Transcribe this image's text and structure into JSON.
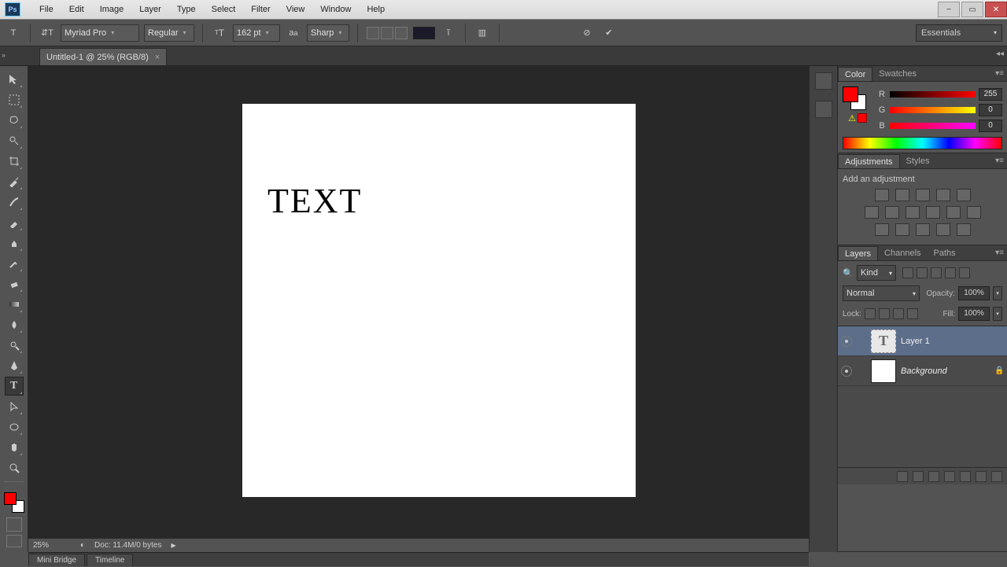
{
  "app": {
    "logo": "Ps"
  },
  "menu": [
    "File",
    "Edit",
    "Image",
    "Layer",
    "Type",
    "Select",
    "Filter",
    "View",
    "Window",
    "Help"
  ],
  "options": {
    "font_family": "Myriad Pro",
    "font_style": "Regular",
    "font_size": "162 pt",
    "antialias": "Sharp"
  },
  "workspace_selector": "Essentials",
  "document": {
    "tab_title": "Untitled-1 @ 25% (RGB/8)",
    "canvas_text": "TEXT"
  },
  "status": {
    "zoom": "25%",
    "doc_info": "Doc: 11.4M/0 bytes"
  },
  "panels": {
    "color": {
      "tabs": [
        "Color",
        "Swatches"
      ],
      "channels": [
        {
          "label": "R",
          "value": "255",
          "gradient": "linear-gradient(to right,#000,#f00)"
        },
        {
          "label": "G",
          "value": "0",
          "gradient": "linear-gradient(to right,#f00,#ff0)"
        },
        {
          "label": "B",
          "value": "0",
          "gradient": "linear-gradient(to right,#f00,#f0f)"
        }
      ]
    },
    "adjustments": {
      "tabs": [
        "Adjustments",
        "Styles"
      ],
      "title": "Add an adjustment"
    },
    "layers": {
      "tabs": [
        "Layers",
        "Channels",
        "Paths"
      ],
      "kind": "Kind",
      "blend": "Normal",
      "opacity_label": "Opacity:",
      "opacity": "100%",
      "lock_label": "Lock:",
      "fill_label": "Fill:",
      "fill": "100%",
      "items": [
        {
          "name": "Layer 1",
          "type": "text",
          "selected": true,
          "locked": false
        },
        {
          "name": "Background",
          "type": "raster",
          "selected": false,
          "locked": true
        }
      ]
    }
  },
  "bottom_tabs": [
    "Mini Bridge",
    "Timeline"
  ]
}
